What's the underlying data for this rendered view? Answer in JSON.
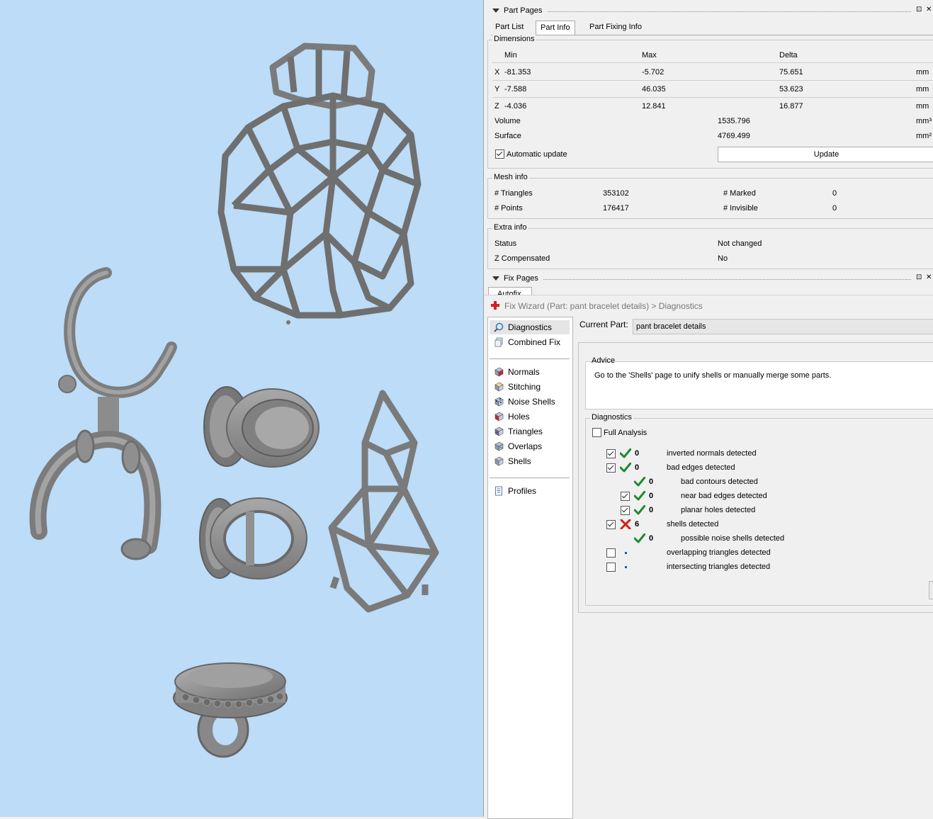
{
  "part_pages": {
    "title": "Part Pages",
    "tabs": [
      "Part List",
      "Part Info",
      "Part Fixing Info"
    ],
    "active_tab": "Part Info",
    "dimensions": {
      "label": "Dimensions",
      "headers": [
        "Min",
        "Max",
        "Delta"
      ],
      "rows": [
        {
          "axis": "X",
          "min": "-81.353",
          "max": "-5.702",
          "delta": "75.651",
          "unit": "mm"
        },
        {
          "axis": "Y",
          "min": "-7.588",
          "max": "46.035",
          "delta": "53.623",
          "unit": "mm"
        },
        {
          "axis": "Z",
          "min": "-4.036",
          "max": "12.841",
          "delta": "16.877",
          "unit": "mm"
        }
      ],
      "volume_label": "Volume",
      "volume": "1535.796",
      "volume_unit": "mm³",
      "surface_label": "Surface",
      "surface": "4769.499",
      "surface_unit": "mm²",
      "auto_update_label": "Automatic update",
      "auto_update": true,
      "update_button": "Update"
    },
    "mesh_info": {
      "label": "Mesh info",
      "triangles_label": "# Triangles",
      "triangles": "353102",
      "points_label": "# Points",
      "points": "176417",
      "marked_label": "# Marked",
      "marked": "0",
      "invisible_label": "# Invisible",
      "invisible": "0"
    },
    "extra_info": {
      "label": "Extra info",
      "status_label": "Status",
      "status": "Not changed",
      "zcomp_label": "Z Compensated",
      "zcomp": "No"
    }
  },
  "fix_pages": {
    "title": "Fix Pages",
    "partial_tab": "Autofix"
  },
  "fix_wizard": {
    "title": "Fix Wizard (Part: pant bracelet details) > Diagnostics",
    "nav_top": [
      "Diagnostics",
      "Combined Fix"
    ],
    "nav_fixes": [
      "Normals",
      "Stitching",
      "Noise Shells",
      "Holes",
      "Triangles",
      "Overlaps",
      "Shells"
    ],
    "nav_bottom": [
      "Profiles"
    ],
    "current_part_label": "Current Part:",
    "current_part": "pant bracelet details",
    "advice_label": "Advice",
    "advice_text": "Go to the 'Shells' page to unify shells or manually merge some parts.",
    "diagnostics_label": "Diagnostics",
    "full_analysis_label": "Full Analysis",
    "items": [
      {
        "checkbox": true,
        "checked": true,
        "status": "ok",
        "count": "0",
        "text": "inverted normals detected",
        "indent": 0
      },
      {
        "checkbox": true,
        "checked": true,
        "status": "ok",
        "count": "0",
        "text": "bad edges detected",
        "indent": 0
      },
      {
        "checkbox": false,
        "checked": false,
        "status": "ok",
        "count": "0",
        "text": "bad contours detected",
        "indent": 1
      },
      {
        "checkbox": true,
        "checked": true,
        "status": "ok",
        "count": "0",
        "text": "near bad edges detected",
        "indent": 1
      },
      {
        "checkbox": true,
        "checked": true,
        "status": "ok",
        "count": "0",
        "text": "planar holes detected",
        "indent": 1
      },
      {
        "checkbox": true,
        "checked": true,
        "status": "fail",
        "count": "6",
        "text": "shells detected",
        "indent": 0
      },
      {
        "checkbox": false,
        "checked": false,
        "status": "ok",
        "count": "0",
        "text": "possible noise shells detected",
        "indent": 1
      },
      {
        "checkbox": true,
        "checked": false,
        "status": "none",
        "count": "",
        "text": "overlapping triangles detected",
        "indent": 0
      },
      {
        "checkbox": true,
        "checked": false,
        "status": "none",
        "count": "",
        "text": "intersecting triangles detected",
        "indent": 0
      }
    ]
  },
  "colors": {
    "viewport_bg": "#bcdcf8",
    "model_gray": "#8a8a8a",
    "ok_green": "#1e8a2e",
    "fail_red": "#d21f1f"
  }
}
